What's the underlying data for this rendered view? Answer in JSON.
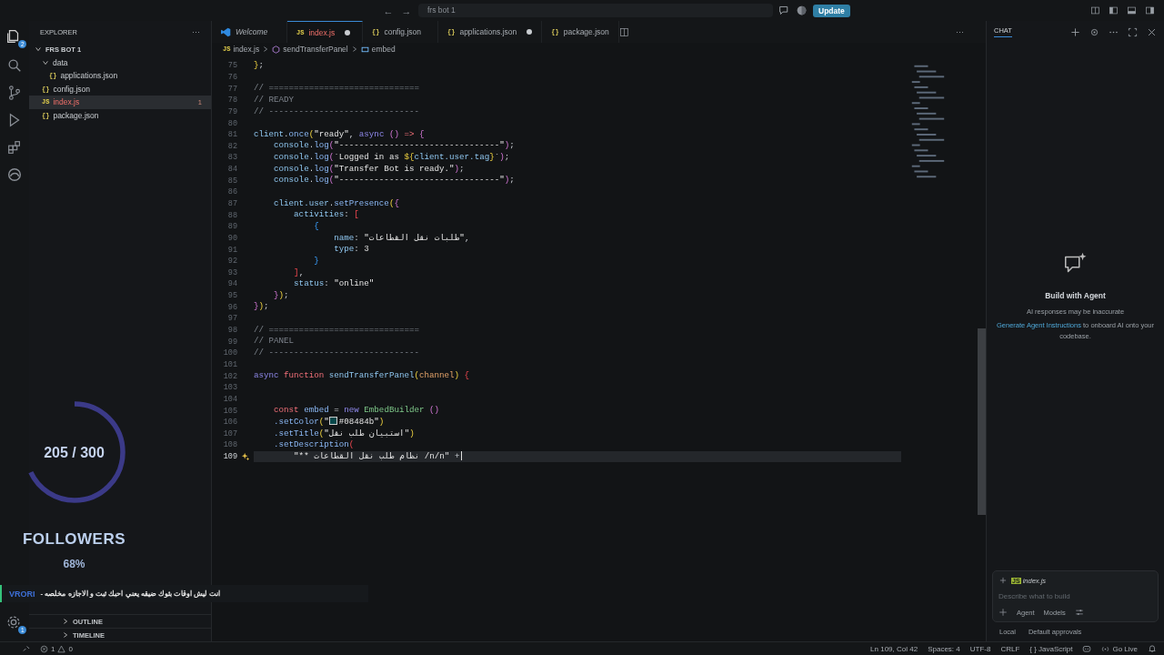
{
  "title_bar": {
    "back": "←",
    "forward": "→",
    "search": "frs bot 1",
    "update_button": "Update"
  },
  "activity_bar": {
    "explorer_badge": "2",
    "settings_badge": "1"
  },
  "explorer": {
    "title": "EXPLORER",
    "more": "···",
    "tree": [
      {
        "label": "FRS BOT 1",
        "kind": "root",
        "expanded": true,
        "selected": false,
        "children": [
          {
            "label": "data",
            "kind": "folder",
            "expanded": true,
            "selected": false,
            "children": [
              {
                "label": "applications.json",
                "kind": "json",
                "icon": "{}",
                "selected": false
              }
            ]
          },
          {
            "label": "config.json",
            "kind": "json",
            "icon": "{}",
            "selected": false
          },
          {
            "label": "index.js",
            "kind": "js",
            "icon": "JS",
            "selected": true,
            "badge": "1"
          },
          {
            "label": "package.json",
            "kind": "json",
            "icon": "{}",
            "selected": false
          }
        ]
      }
    ],
    "sections": [
      {
        "label": "OUTLINE",
        "expanded": false
      },
      {
        "label": "TIMELINE",
        "expanded": false
      }
    ]
  },
  "tabs": [
    {
      "label": "Welcome",
      "kind": "welcome",
      "selected": false,
      "modified": false
    },
    {
      "label": "index.js",
      "kind": "js",
      "icon": "JS",
      "selected": true,
      "modified": true
    },
    {
      "label": "config.json",
      "kind": "json",
      "icon": "{}",
      "selected": false,
      "modified": false
    },
    {
      "label": "applications.json",
      "kind": "json",
      "icon": "{}",
      "selected": false,
      "modified": true
    },
    {
      "label": "package.json",
      "kind": "json",
      "icon": "{}",
      "selected": false,
      "modified": false
    }
  ],
  "editor_actions": {
    "more": "···"
  },
  "breadcrumbs": [
    {
      "label": "index.js",
      "kind": "js",
      "icon": "JS"
    },
    {
      "label": "sendTransferPanel",
      "kind": "function"
    },
    {
      "label": "embed",
      "kind": "variable"
    }
  ],
  "code": {
    "lines": [
      {
        "n": "75",
        "tokens": [
          {
            "kind": "b1",
            "text": "}"
          },
          {
            "kind": "plain",
            "text": ";"
          }
        ]
      },
      {
        "n": "76"
      },
      {
        "n": "77",
        "tokens": [
          {
            "kind": "comment",
            "text": "// =============================="
          }
        ]
      },
      {
        "n": "78",
        "tokens": [
          {
            "kind": "comment",
            "text": "// READY"
          }
        ]
      },
      {
        "n": "79",
        "tokens": [
          {
            "kind": "comment",
            "text": "// ------------------------------"
          }
        ]
      },
      {
        "n": "80"
      },
      {
        "n": "81",
        "tokens": [
          {
            "kind": "var",
            "text": "client"
          },
          {
            "kind": "plain",
            "text": "."
          },
          {
            "kind": "method",
            "text": "once"
          },
          {
            "kind": "b1",
            "text": "("
          },
          {
            "kind": "string",
            "text": "\"ready\""
          },
          {
            "kind": "plain",
            "text": ", "
          },
          {
            "kind": "kw",
            "text": "async "
          },
          {
            "kind": "b2",
            "text": "() "
          },
          {
            "kind": "kw2",
            "text": "=> "
          },
          {
            "kind": "b2",
            "text": "{"
          }
        ]
      },
      {
        "n": "82",
        "tokens": [
          {
            "kind": "var",
            "text": "    console"
          },
          {
            "kind": "plain",
            "text": "."
          },
          {
            "kind": "method",
            "text": "log"
          },
          {
            "kind": "b2",
            "text": "("
          },
          {
            "kind": "string",
            "text": "\"--------------------------------\""
          },
          {
            "kind": "b2",
            "text": ")"
          },
          {
            "kind": "plain",
            "text": ";"
          }
        ]
      },
      {
        "n": "83",
        "tokens": [
          {
            "kind": "var",
            "text": "    console"
          },
          {
            "kind": "plain",
            "text": "."
          },
          {
            "kind": "method",
            "text": "log"
          },
          {
            "kind": "b2",
            "text": "("
          },
          {
            "kind": "string",
            "text": "`Logged in as "
          },
          {
            "kind": "b1",
            "text": "${"
          },
          {
            "kind": "var",
            "text": "client.user.tag"
          },
          {
            "kind": "b1",
            "text": "}"
          },
          {
            "kind": "string",
            "text": "`"
          },
          {
            "kind": "b2",
            "text": ")"
          },
          {
            "kind": "plain",
            "text": ";"
          }
        ]
      },
      {
        "n": "84",
        "tokens": [
          {
            "kind": "var",
            "text": "    console"
          },
          {
            "kind": "plain",
            "text": "."
          },
          {
            "kind": "method",
            "text": "log"
          },
          {
            "kind": "b2",
            "text": "("
          },
          {
            "kind": "string",
            "text": "\"Transfer Bot is ready.\""
          },
          {
            "kind": "b2",
            "text": ")"
          },
          {
            "kind": "plain",
            "text": ";"
          }
        ]
      },
      {
        "n": "85",
        "tokens": [
          {
            "kind": "var",
            "text": "    console"
          },
          {
            "kind": "plain",
            "text": "."
          },
          {
            "kind": "method",
            "text": "log"
          },
          {
            "kind": "b2",
            "text": "("
          },
          {
            "kind": "string",
            "text": "\"--------------------------------\""
          },
          {
            "kind": "b2",
            "text": ")"
          },
          {
            "kind": "plain",
            "text": ";"
          }
        ]
      },
      {
        "n": "86"
      },
      {
        "n": "87",
        "tokens": [
          {
            "kind": "var",
            "text": "    client.user"
          },
          {
            "kind": "plain",
            "text": "."
          },
          {
            "kind": "method",
            "text": "setPresence"
          },
          {
            "kind": "b1",
            "text": "("
          },
          {
            "kind": "b2",
            "text": "{"
          }
        ]
      },
      {
        "n": "88",
        "tokens": [
          {
            "kind": "var",
            "text": "        activities"
          },
          {
            "kind": "plain",
            "text": ": "
          },
          {
            "kind": "err",
            "text": "["
          }
        ]
      },
      {
        "n": "89",
        "tokens": [
          {
            "kind": "b3",
            "text": "            {"
          }
        ]
      },
      {
        "n": "90",
        "tokens": [
          {
            "kind": "var",
            "text": "                name"
          },
          {
            "kind": "plain",
            "text": ": "
          },
          {
            "kind": "string",
            "text": "\"طلبات نقل القطاعات\""
          },
          {
            "kind": "plain",
            "text": ","
          }
        ]
      },
      {
        "n": "91",
        "tokens": [
          {
            "kind": "var",
            "text": "                type"
          },
          {
            "kind": "plain",
            "text": ": "
          },
          {
            "kind": "num",
            "text": "3"
          }
        ]
      },
      {
        "n": "92",
        "tokens": [
          {
            "kind": "b3",
            "text": "            }"
          }
        ]
      },
      {
        "n": "93",
        "tokens": [
          {
            "kind": "err",
            "text": "        ]"
          },
          {
            "kind": "plain",
            "text": ","
          }
        ]
      },
      {
        "n": "94",
        "tokens": [
          {
            "kind": "var",
            "text": "        status"
          },
          {
            "kind": "plain",
            "text": ": "
          },
          {
            "kind": "string",
            "text": "\"online\""
          }
        ]
      },
      {
        "n": "95",
        "tokens": [
          {
            "kind": "b2",
            "text": "    }"
          },
          {
            "kind": "b1",
            "text": ")"
          },
          {
            "kind": "plain",
            "text": ";"
          }
        ]
      },
      {
        "n": "96",
        "tokens": [
          {
            "kind": "b2",
            "text": "}"
          },
          {
            "kind": "b1",
            "text": ")"
          },
          {
            "kind": "plain",
            "text": ";"
          }
        ]
      },
      {
        "n": "97"
      },
      {
        "n": "98",
        "tokens": [
          {
            "kind": "comment",
            "text": "// =============================="
          }
        ]
      },
      {
        "n": "99",
        "tokens": [
          {
            "kind": "comment",
            "text": "// PANEL"
          }
        ]
      },
      {
        "n": "100",
        "tokens": [
          {
            "kind": "comment",
            "text": "// ------------------------------"
          }
        ]
      },
      {
        "n": "101"
      },
      {
        "n": "102",
        "tokens": [
          {
            "kind": "kw",
            "text": "async "
          },
          {
            "kind": "kw2",
            "text": "function "
          },
          {
            "kind": "var",
            "text": "sendTransferPanel"
          },
          {
            "kind": "b1",
            "text": "("
          },
          {
            "kind": "param",
            "text": "channel"
          },
          {
            "kind": "b1",
            "text": ") "
          },
          {
            "kind": "err",
            "text": "{"
          }
        ]
      },
      {
        "n": "103"
      },
      {
        "n": "104"
      },
      {
        "n": "105",
        "tokens": [
          {
            "kind": "kw2",
            "text": "    const "
          },
          {
            "kind": "method",
            "text": "embed"
          },
          {
            "kind": "plain",
            "text": " = "
          },
          {
            "kind": "kw",
            "text": "new "
          },
          {
            "kind": "class",
            "text": "EmbedBuilder "
          },
          {
            "kind": "b2",
            "text": "()"
          }
        ]
      },
      {
        "n": "106",
        "tokens": [
          {
            "kind": "method",
            "text": "    .setColor"
          },
          {
            "kind": "b1",
            "text": "("
          },
          {
            "kind": "string",
            "text": "\""
          },
          {
            "kind": "color",
            "text": "#08484b"
          },
          {
            "kind": "string",
            "text": "\""
          },
          {
            "kind": "b1",
            "text": ")"
          }
        ]
      },
      {
        "n": "107",
        "tokens": [
          {
            "kind": "method",
            "text": "    .setTitle"
          },
          {
            "kind": "b1",
            "text": "("
          },
          {
            "kind": "string",
            "text": "\"استبيان طلب نقل\""
          },
          {
            "kind": "b1",
            "text": ")"
          }
        ]
      },
      {
        "n": "108",
        "tokens": [
          {
            "kind": "method",
            "text": "    .setDescription"
          },
          {
            "kind": "err",
            "text": "("
          }
        ]
      },
      {
        "n": "109",
        "current": true,
        "hint": true,
        "tokens": [
          {
            "kind": "string",
            "text": "        \"** نظام طلب نقل القطاعات /n/n\""
          },
          {
            "kind": "plain",
            "text": " +"
          }
        ]
      }
    ]
  },
  "stream_overlay": {
    "count": "205 / 300",
    "level": 0.68,
    "label": "FOLLOWERS",
    "percent": "68%",
    "ticker_name": "VRORI",
    "ticker_message": "انت ليش اوقات بثوك ضيقه يعني احبك ثبت و الاجازه مخلصه -"
  },
  "chat": {
    "title": "CHAT",
    "heading": "Build with Agent",
    "note": "AI responses may be inaccurate",
    "link": "Generate Agent Instructions",
    "link_rest": " to onboard AI onto your codebase.",
    "context_file": {
      "label": "index.js",
      "icon": "JS"
    },
    "placeholder": "Describe what to build",
    "mode": "Agent",
    "models": "Models",
    "footer": [
      "Local",
      "Default approvals"
    ]
  },
  "status_bar": {
    "errors": "1",
    "warnings": "0",
    "items": [
      {
        "text": "Ln 109, Col 42",
        "kind": "text"
      },
      {
        "text": "Spaces: 4",
        "kind": "text"
      },
      {
        "text": "UTF-8",
        "kind": "text"
      },
      {
        "text": "CRLF",
        "kind": "text"
      },
      {
        "text": "JavaScript",
        "kind": "language",
        "icon": "{ }"
      },
      {
        "kind": "copilot"
      },
      {
        "text": "Go Live",
        "kind": "live"
      },
      {
        "kind": "bell"
      }
    ]
  }
}
